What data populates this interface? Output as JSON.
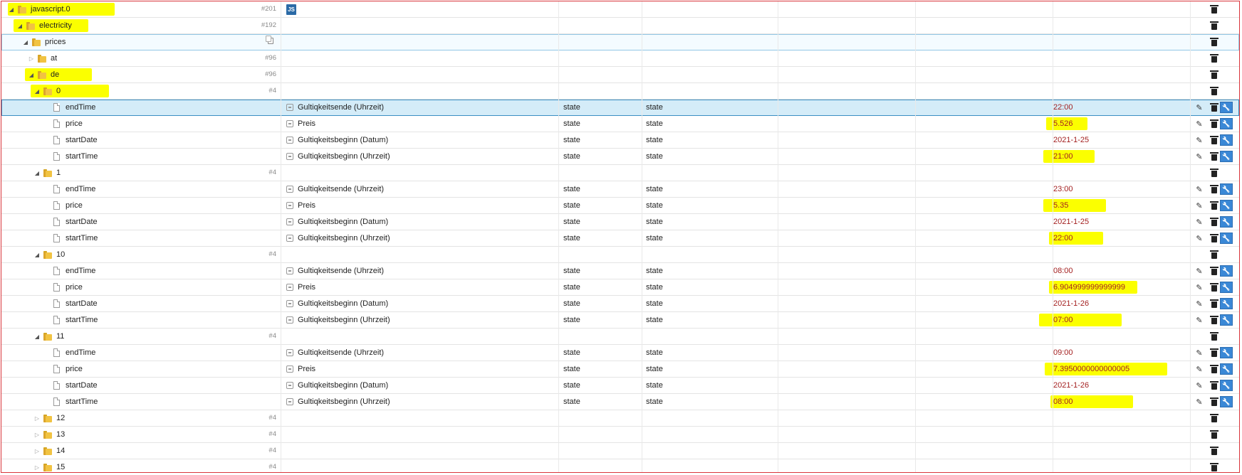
{
  "rows": [
    {
      "name": "javascript.0",
      "kind": "folder",
      "indent": 0,
      "open": true,
      "count": "#201",
      "icon": "js-icon",
      "icon_label": "JS",
      "hl": [
        0,
        150
      ]
    },
    {
      "name": "electricity",
      "kind": "folder",
      "indent": 1,
      "open": true,
      "count": "#192",
      "hl": [
        -4,
        105
      ]
    },
    {
      "name": "prices",
      "kind": "folder",
      "indent": 2,
      "open": true,
      "copy": true,
      "current": true
    },
    {
      "name": "at",
      "kind": "folder",
      "indent": 3,
      "open": false,
      "count": "#96"
    },
    {
      "name": "de",
      "kind": "folder",
      "indent": 3,
      "open": true,
      "count": "#96",
      "hl": [
        -4,
        94
      ]
    },
    {
      "name": "0",
      "kind": "folder",
      "indent": 4,
      "open": true,
      "count": "#4",
      "hl": [
        -4,
        110
      ]
    },
    {
      "name": "endTime",
      "kind": "state",
      "indent": 5,
      "role": "Gultiqkeitsende (Uhrzeit)",
      "type": "state",
      "common": "state",
      "value": "22:00",
      "selected": true
    },
    {
      "name": "price",
      "kind": "state",
      "indent": 5,
      "role": "Preis",
      "type": "state",
      "common": "state",
      "value": "5.526",
      "vhl": [
        -10,
        58
      ]
    },
    {
      "name": "startDate",
      "kind": "state",
      "indent": 5,
      "role": "Gultiqkeitsbeginn (Datum)",
      "type": "state",
      "common": "state",
      "value": "2021-1-25"
    },
    {
      "name": "startTime",
      "kind": "state",
      "indent": 5,
      "role": "Gultiqkeitsbeginn (Uhrzeit)",
      "type": "state",
      "common": "state",
      "value": "21:00",
      "vhl": [
        -14,
        72
      ]
    },
    {
      "name": "1",
      "kind": "folder",
      "indent": 4,
      "open": true,
      "count": "#4"
    },
    {
      "name": "endTime",
      "kind": "state",
      "indent": 5,
      "role": "Gultiqkeitsende (Uhrzeit)",
      "type": "state",
      "common": "state",
      "value": "23:00"
    },
    {
      "name": "price",
      "kind": "state",
      "indent": 5,
      "role": "Preis",
      "type": "state",
      "common": "state",
      "value": "5.35",
      "vhl": [
        -14,
        88
      ]
    },
    {
      "name": "startDate",
      "kind": "state",
      "indent": 5,
      "role": "Gultiqkeitsbeginn (Datum)",
      "type": "state",
      "common": "state",
      "value": "2021-1-25"
    },
    {
      "name": "startTime",
      "kind": "state",
      "indent": 5,
      "role": "Gultiqkeitsbeginn (Uhrzeit)",
      "type": "state",
      "common": "state",
      "value": "22:00",
      "vhl": [
        -6,
        76
      ]
    },
    {
      "name": "10",
      "kind": "folder",
      "indent": 4,
      "open": true,
      "count": "#4"
    },
    {
      "name": "endTime",
      "kind": "state",
      "indent": 5,
      "role": "Gultiqkeitsende (Uhrzeit)",
      "type": "state",
      "common": "state",
      "value": "08:00"
    },
    {
      "name": "price",
      "kind": "state",
      "indent": 5,
      "role": "Preis",
      "type": "state",
      "common": "state",
      "value": "6.904999999999999",
      "vhl": [
        -6,
        124
      ]
    },
    {
      "name": "startDate",
      "kind": "state",
      "indent": 5,
      "role": "Gultiqkeitsbeginn (Datum)",
      "type": "state",
      "common": "state",
      "value": "2021-1-26"
    },
    {
      "name": "startTime",
      "kind": "state",
      "indent": 5,
      "role": "Gultiqkeitsbeginn (Uhrzeit)",
      "type": "state",
      "common": "state",
      "value": "07:00",
      "vhl": [
        -20,
        116
      ]
    },
    {
      "name": "11",
      "kind": "folder",
      "indent": 4,
      "open": true,
      "count": "#4"
    },
    {
      "name": "endTime",
      "kind": "state",
      "indent": 5,
      "role": "Gultiqkeitsende (Uhrzeit)",
      "type": "state",
      "common": "state",
      "value": "09:00"
    },
    {
      "name": "price",
      "kind": "state",
      "indent": 5,
      "role": "Preis",
      "type": "state",
      "common": "state",
      "value": "7.3950000000000005",
      "vhl": [
        -12,
        172
      ]
    },
    {
      "name": "startDate",
      "kind": "state",
      "indent": 5,
      "role": "Gultiqkeitsbeginn (Datum)",
      "type": "state",
      "common": "state",
      "value": "2021-1-26"
    },
    {
      "name": "startTime",
      "kind": "state",
      "indent": 5,
      "role": "Gultiqkeitsbeginn (Uhrzeit)",
      "type": "state",
      "common": "state",
      "value": "08:00",
      "vhl": [
        -4,
        116
      ]
    },
    {
      "name": "12",
      "kind": "folder",
      "indent": 4,
      "open": false,
      "count": "#4"
    },
    {
      "name": "13",
      "kind": "folder",
      "indent": 4,
      "open": false,
      "count": "#4"
    },
    {
      "name": "14",
      "kind": "folder",
      "indent": 4,
      "open": false,
      "count": "#4"
    },
    {
      "name": "15",
      "kind": "folder",
      "indent": 4,
      "open": false,
      "count": "#4"
    }
  ],
  "icons": {
    "edit": "pencil-icon",
    "delete": "trash-icon",
    "settings": "wrench-icon",
    "copy": "copy-icon",
    "state": "file-icon",
    "folder": "folder-icon"
  },
  "colors": {
    "highlight": "#fbff00",
    "value_text": "#a42121",
    "selected_row": "#d4ecf8",
    "wrench_button": "#3a88d6",
    "frame_border": "#d9353b"
  }
}
